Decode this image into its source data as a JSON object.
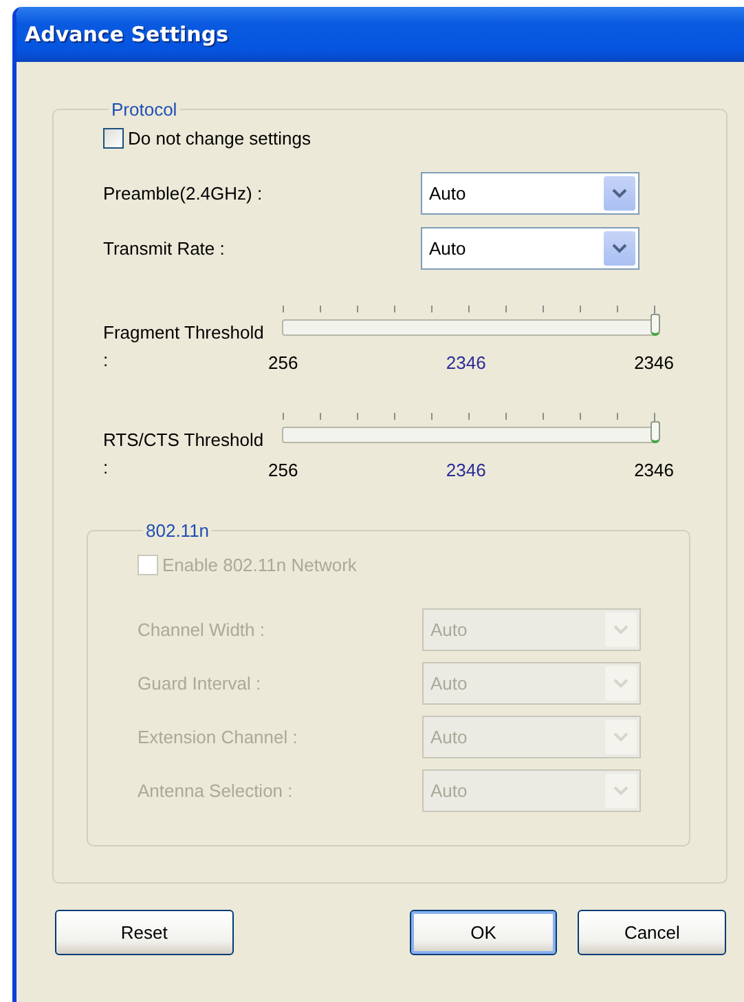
{
  "window": {
    "title": "Advance Settings"
  },
  "protocol": {
    "title": "Protocol",
    "do_not_change": {
      "label": "Do not change settings",
      "checked": false
    },
    "selects": [
      {
        "label": "Preamble(2.4GHz) :",
        "value": "Auto",
        "disabled": false
      },
      {
        "label": "Transmit Rate :",
        "value": "Auto",
        "disabled": false
      }
    ],
    "sliders": [
      {
        "label": "Fragment Threshold :",
        "level": 1,
        "min": "256",
        "current": "2346",
        "max": "2346"
      },
      {
        "label": "RTS/CTS Threshold :",
        "level": 1,
        "min": "256",
        "current": "2346",
        "max": "2346"
      }
    ],
    "n_group": {
      "title": "802.11n",
      "enable": {
        "label": "Enable 802.11n Network",
        "checked": false,
        "disabled": true
      },
      "selects": [
        {
          "label": "Channel Width :",
          "value": "Auto",
          "disabled": true
        },
        {
          "label": "Guard Interval :",
          "value": "Auto",
          "disabled": true
        },
        {
          "label": "Extension Channel :",
          "value": "Auto",
          "disabled": true
        },
        {
          "label": "Antenna Selection :",
          "value": "Auto",
          "disabled": true
        }
      ]
    }
  },
  "buttons": [
    {
      "label": "Reset",
      "default": false
    },
    {
      "label": "OK",
      "default": true
    },
    {
      "label": "Cancel",
      "default": false
    }
  ]
}
